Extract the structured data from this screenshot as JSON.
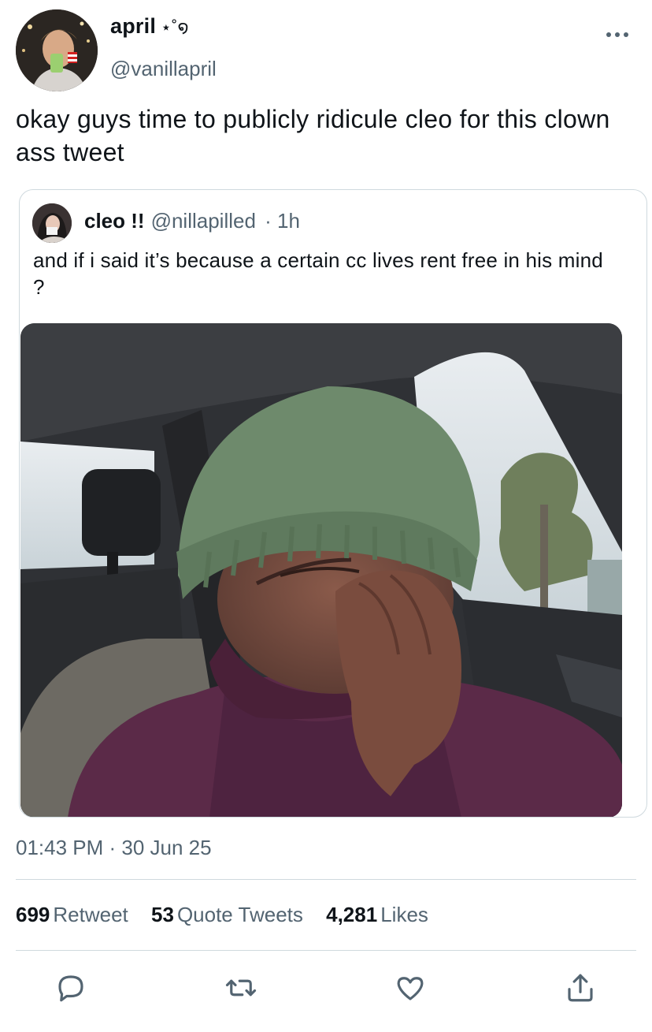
{
  "author": {
    "display_name": "april",
    "name_decoration": "⋆˚໑",
    "handle": "@vanillapril",
    "more_icon": "more-horizontal-icon"
  },
  "tweet": {
    "text": "okay guys time to publicly ridicule cleo for this clown ass tweet",
    "timestamp": "01:43 PM · 30 Jun 25"
  },
  "quoted_tweet": {
    "display_name": "cleo !!",
    "handle": "@nillapilled",
    "age": "· 1h",
    "text": "and if i said it’s because a certain cc lives rent free in his mind ?"
  },
  "stats": [
    {
      "count": "699",
      "label": "Retweet"
    },
    {
      "count": "53",
      "label": "Quote Tweets"
    },
    {
      "count": "4,281",
      "label": "Likes"
    }
  ],
  "actions": [
    "reply-icon",
    "retweet-icon",
    "like-icon",
    "share-icon"
  ],
  "colors": {
    "text": "#0f1419",
    "secondary": "#536471",
    "border": "#cfd9de"
  }
}
